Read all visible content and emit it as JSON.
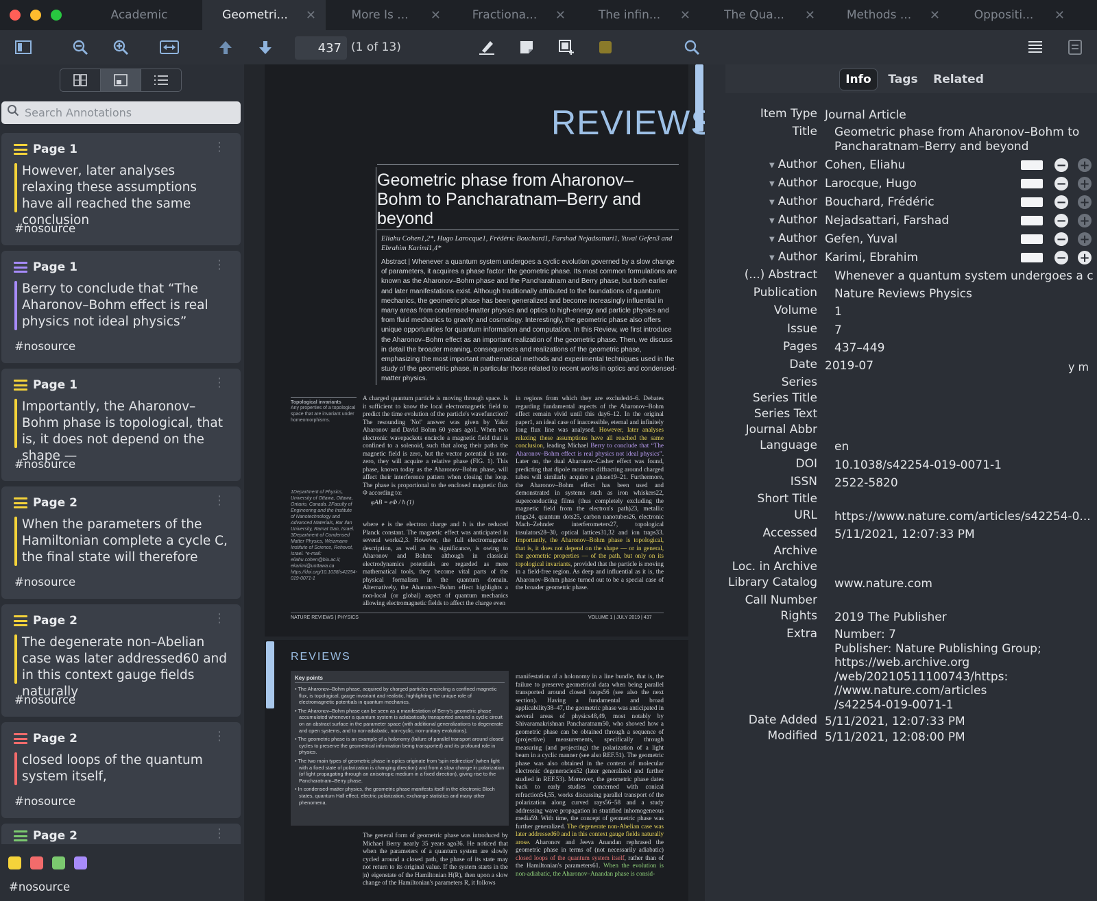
{
  "tabs": [
    {
      "label": "Academic",
      "active": false,
      "closable": false
    },
    {
      "label": "Geometri...",
      "active": true,
      "closable": true
    },
    {
      "label": "More Is ...",
      "active": false,
      "closable": true
    },
    {
      "label": "Fractiona...",
      "active": false,
      "closable": true
    },
    {
      "label": "The infin...",
      "active": false,
      "closable": true
    },
    {
      "label": "The Qua...",
      "active": false,
      "closable": true
    },
    {
      "label": "Methods ...",
      "active": false,
      "closable": true
    },
    {
      "label": "Oppositi...",
      "active": false,
      "closable": true
    }
  ],
  "toolbar": {
    "page_number": "437",
    "page_of": "(1 of 13)",
    "icons": [
      "toggle-sidebar-icon",
      "zoom-out-icon",
      "zoom-in-icon",
      "fit-width-icon",
      "previous-page-icon",
      "next-page-icon",
      "highlight-icon",
      "note-icon",
      "area-select-icon",
      "color-picker-icon",
      "find-icon",
      "outline-icon",
      "context-pane-icon"
    ],
    "color_picker": "#8a7a2a"
  },
  "sidebar": {
    "search_placeholder": "Search Annotations",
    "view_modes": [
      "thumbnails",
      "annotations",
      "outline"
    ],
    "annotations": [
      {
        "page": "Page 1",
        "color": "#f5d33a",
        "text": "However, later analyses relaxing these assumptions have all reached the same conclusion",
        "tag": "#nosource"
      },
      {
        "page": "Page 1",
        "color": "#a78bfa",
        "text": "Berry to conclude that “The Aharonov–Bohm effect is real physics not ideal physics”",
        "tag": "#nosource"
      },
      {
        "page": "Page 1",
        "color": "#f5d33a",
        "text": "Importantly, the Aharonov–Bohm phase is topological, that is, it does not depend on the shape —",
        "tag": "#nosource"
      },
      {
        "page": "Page 2",
        "color": "#f5d33a",
        "text": "When the parameters of the Hamiltonian complete a cycle C, the final state will therefore",
        "tag": "#nosource"
      },
      {
        "page": "Page 2",
        "color": "#f5d33a",
        "text": "The degenerate non–Abelian case was later addressed60 and in this context gauge fields naturally",
        "tag": "#nosource"
      },
      {
        "page": "Page 2",
        "color": "#f26b6b",
        "text": "closed loops of the quantum system itself,",
        "tag": "#nosource"
      },
      {
        "page": "Page 2",
        "color": "#7bc96f",
        "text": "",
        "tag": ""
      }
    ],
    "swatches": [
      "#f5d33a",
      "#f26b6b",
      "#7bc96f",
      "#a78bfa"
    ],
    "bottom_tag": "#nosource"
  },
  "document": {
    "header": "REVIEWS",
    "title": "Geometric phase from Aharonov–Bohm to Pancharatnam–Berry and beyond",
    "authors": "Eliahu Cohen1,2*, Hugo Larocque1, Frédéric Bouchard1, Farshad Nejadsattari1, Yuval Gefen3 and Ebrahim Karimi1,4*",
    "abstract": "Abstract | Whenever a quantum system undergoes a cyclic evolution governed by a slow change of parameters, it acquires a phase factor: the geometric phase. Its most common formulations are known as the Aharonov–Bohm phase and the Pancharatnam and Berry phase, but both earlier and later manifestations exist. Although traditionally attributed to the foundations of quantum mechanics, the geometric phase has been generalized and become increasingly influential in many areas from condensed-matter physics and optics to high-energy and particle physics and from fluid mechanics to gravity and cosmology. Interestingly, the geometric phase also offers unique opportunities for quantum information and computation. In this Review, we first introduce the Aharonov–Bohm effect as an important realization of the geometric phase. Then, we discuss in detail the broader meaning, consequences and realizations of the geometric phase, emphasizing the most important mathematical methods and experimental techniques used in the study of the geometric phase, in particular those related to recent works in optics and condensed-matter physics.",
    "margin_topo_title": "Topological invariants",
    "margin_topo_text": "Any properties of a topological space that are invariant under homeomorphisms.",
    "affiliations": "1Department of Physics, University of Ottawa, Ottawa, Ontario, Canada. 2Faculty of Engineering and the Institute of Nanotechnology and Advanced Materials, Bar Ilan University, Ramat Gan, Israel. 3Department of Condensed Matter Physics, Weizmann Institute of Science, Rehovot, Israel. *e-mail: eliahu.cohen@biu.ac.il; ekarimi@uottawa.ca https://doi.org/10.1038/s42254-019-0071-1",
    "col1_a": "A charged quantum particle is moving through space. Is it sufficient to know the local electromagnetic field to predict the time evolution of the particle's wavefunction? The resounding 'No!' answer was given by Yakir Aharonov and David Bohm 60 years ago1. When two electronic wavepackets encircle a magnetic field that is confined to a solenoid, such that along their paths the magnetic field is zero, but the vector potential is non-zero, they will acquire a relative phase (FIG. 1). This phase, known today as the Aharonov–Bohm phase, will affect their interference pattern when closing the loop. The phase is proportional to the enclosed magnetic flux Φ according to:",
    "equation": "φAB = eΦ / ħ     (1)",
    "col1_b": "where e is the electron charge and ħ is the reduced Planck constant. The magnetic effect was anticipated in several works2,3. However, the full electromagnetic description, as well as its significance, is owing to Aharonov and Bohm: although in classical electrodynamics potentials are regarded as mere mathematical tools, they become vital parts of the physical formalism in the quantum domain. Alternatively, the Aharonov–Bohm effect highlights a non-local (or global) aspect of quantum mechanics allowing electromagnetic fields to affect the charge even",
    "col2_a": "in regions from which they are excluded4–6. Debates regarding fundamental aspects of the Aharonov–Bohm effect remain vivid until this day6–12.",
    "col2_b": "In the original paper1, an ideal case of inaccessible, eternal and infinitely long flux line was analysed.",
    "col2_hl_yellow": "However, later analyses relaxing these assumptions have all reached the same conclusion",
    "col2_c": ", leading Michael",
    "col2_hl_purple": "Berry to conclude that “The Aharonov–Bohm effect is real physics not ideal physics”",
    "col2_d": ". Later on, the dual Aharonov–Casher effect was found, predicting that dipole moments diffracting around charged tubes will similarly acquire a phase19–21. Furthermore, the Aharonov–Bohm effect has been used and demonstrated in systems such as iron whiskers22, superconducting films (thus completely excluding the magnetic field from the electron's path)23, metallic rings24, quantum dots25, carbon nanotubes26, electronic Mach–Zehnder interferometers27, topological insulators28–30, optical lattices31,32 and ion traps33.",
    "col2_hl_yellow2": "Importantly, the Aharonov–Bohm phase is topological, that is, it does not depend on the shape — or in general, the geometric properties — of the path, but only on its topological invariants",
    "col2_e": ", provided that the particle is moving in a field-free region. As deep and influential as it is, the Aharonov–Bohm phase turned out to be a special case of the broader geometric phase.",
    "footer_left": "NATURE REVIEWS | PHYSICS",
    "footer_right": "VOLUME 1 | JULY 2019 | 437",
    "page2_header": "REVIEWS",
    "keypoints_head": "Key points",
    "keypoints": [
      "• The Aharonov–Bohm phase, acquired by charged particles encircling a confined magnetic flux, is topological, gauge invariant and realistic, highlighting the unique role of electromagnetic potentials in quantum mechanics.",
      "• The Aharonov–Bohm phase can be seen as a manifestation of Berry's geometric phase accumulated whenever a quantum system is adiabatically transported around a cyclic circuit on an abstract surface in the parameter space (with additional generalizations to degenerate and open systems, and to non-adiabatic, non-cyclic, non-unitary evolutions).",
      "• The geometric phase is an example of a holonomy (failure of parallel transport around closed cycles to preserve the geometrical information being transported) and its profound role in physics.",
      "• The two main types of geometric phase in optics originate from 'spin redirection' (when light with a fixed state of polarization is changing direction) and from a slow change in polarization (of light propagating through an anisotropic medium in a fixed direction), giving rise to the Pancharatnam–Berry phase.",
      "• In condensed-matter physics, the geometric phase manifests itself in the electronic Bloch states, quantum Hall effect, electric polarization, exchange statistics and many other phenomena."
    ],
    "p2_col2": "manifestation of a holonomy in a line bundle, that is, the failure to preserve geometrical data when being parallel transported around closed loops56 (see also the next section). Having a fundamental and broad applicability38–47, the geometric phase was anticipated in several areas of physics48,49, most notably by Shivaramakrishnan Pancharatnam50, who showed how a geometric phase can be obtained through a sequence of (projective) measurements, specifically through measuring (and projecting) the polarization of a light beam in a cyclic manner (see also REF.51). The geometric phase was also obtained in the context of molecular electronic degeneracies52 (later generalized and further studied in REF.53). Moreover, the geometric phase dates back to early studies concerned with conical refraction54,55, works discussing parallel transport of the polarization along curved rays56–58 and a study addressing wave propagation in stratified inhomogeneous media59. With time, the concept of geometric phase was further generalized.",
    "p2_col2_hl_yellow": "The degenerate non-Abelian case was later addressed60 and in this context gauge fields naturally arose.",
    "p2_col2_b": " Aharonov and Jeeva Anandan rephrased the geometric phase in terms of (not necessarily adiabatic)",
    "p2_col2_hl_red": "closed loops of the quantum system itself",
    "p2_col2_c": ", rather than of the Hamiltonian's parameters61.",
    "p2_col2_hl_green": "When the evolution is non-adiabatic, the Aharonov–Anandan phase is consid-",
    "p2_col1": "The general form of geometric phase was introduced by Michael Berry nearly 35 years ago36. He noticed that when the parameters of a quantum system are slowly cycled around a closed path, the phase of its state may not return to its original value. If the system starts in the |n⟩ eigenstate of the Hamiltonian H(R), then upon a slow change of the Hamiltonian's parameters R, it follows"
  },
  "info": {
    "tabs": [
      "Info",
      "Tags",
      "Related"
    ],
    "item_type_label": "Item Type",
    "item_type": "Journal Article",
    "title_label": "Title",
    "title": "Geometric phase from Aharonov–Bohm to Pancharatnam–Berry and beyond",
    "author_label": "Author",
    "authors": [
      "Cohen, Eliahu",
      "Larocque, Hugo",
      "Bouchard, Frédéric",
      "Nejadsattari, Farshad",
      "Gefen, Yuval",
      "Karimi, Ebrahim"
    ],
    "abstract_label": "(...) Abstract",
    "abstract": "Whenever a quantum system undergoes a cy...",
    "publication_label": "Publication",
    "publication": "Nature Reviews Physics",
    "volume_label": "Volume",
    "volume": "1",
    "issue_label": "Issue",
    "issue": "7",
    "pages_label": "Pages",
    "pages": "437–449",
    "date_label": "Date",
    "date": "2019-07",
    "date_format": "y m",
    "series_label": "Series",
    "series_title_label": "Series Title",
    "series_text_label": "Series Text",
    "journal_abbr_label": "Journal Abbr",
    "language_label": "Language",
    "language": "en",
    "doi_label": "DOI",
    "doi": "10.1038/s42254-019-0071-1",
    "issn_label": "ISSN",
    "issn": "2522-5820",
    "short_title_label": "Short Title",
    "url_label": "URL",
    "url": "https://www.nature.com/articles/s42254-0...",
    "accessed_label": "Accessed",
    "accessed": "5/11/2021, 12:07:33 PM",
    "archive_label": "Archive",
    "loc_archive_label": "Loc. in Archive",
    "library_catalog_label": "Library Catalog",
    "library_catalog": "www.nature.com",
    "call_number_label": "Call Number",
    "rights_label": "Rights",
    "rights": "2019 The Publisher",
    "extra_label": "Extra",
    "extra": "Number: 7\nPublisher: Nature Publishing Group; https://web.archive.org/web/20210511100743/https://www.nature.com/articles/s42254-019-0071-1",
    "extra_lines": [
      "Number: 7",
      "Publisher: Nature Publishing Group;",
      "https://web.archive.org",
      "/web/20210511100743/https:",
      "//www.nature.com/articles",
      "/s42254-019-0071-1"
    ],
    "date_added_label": "Date Added",
    "date_added": "5/11/2021, 12:07:33 PM",
    "modified_label": "Modified",
    "modified": "5/11/2021, 12:08:00 PM"
  }
}
